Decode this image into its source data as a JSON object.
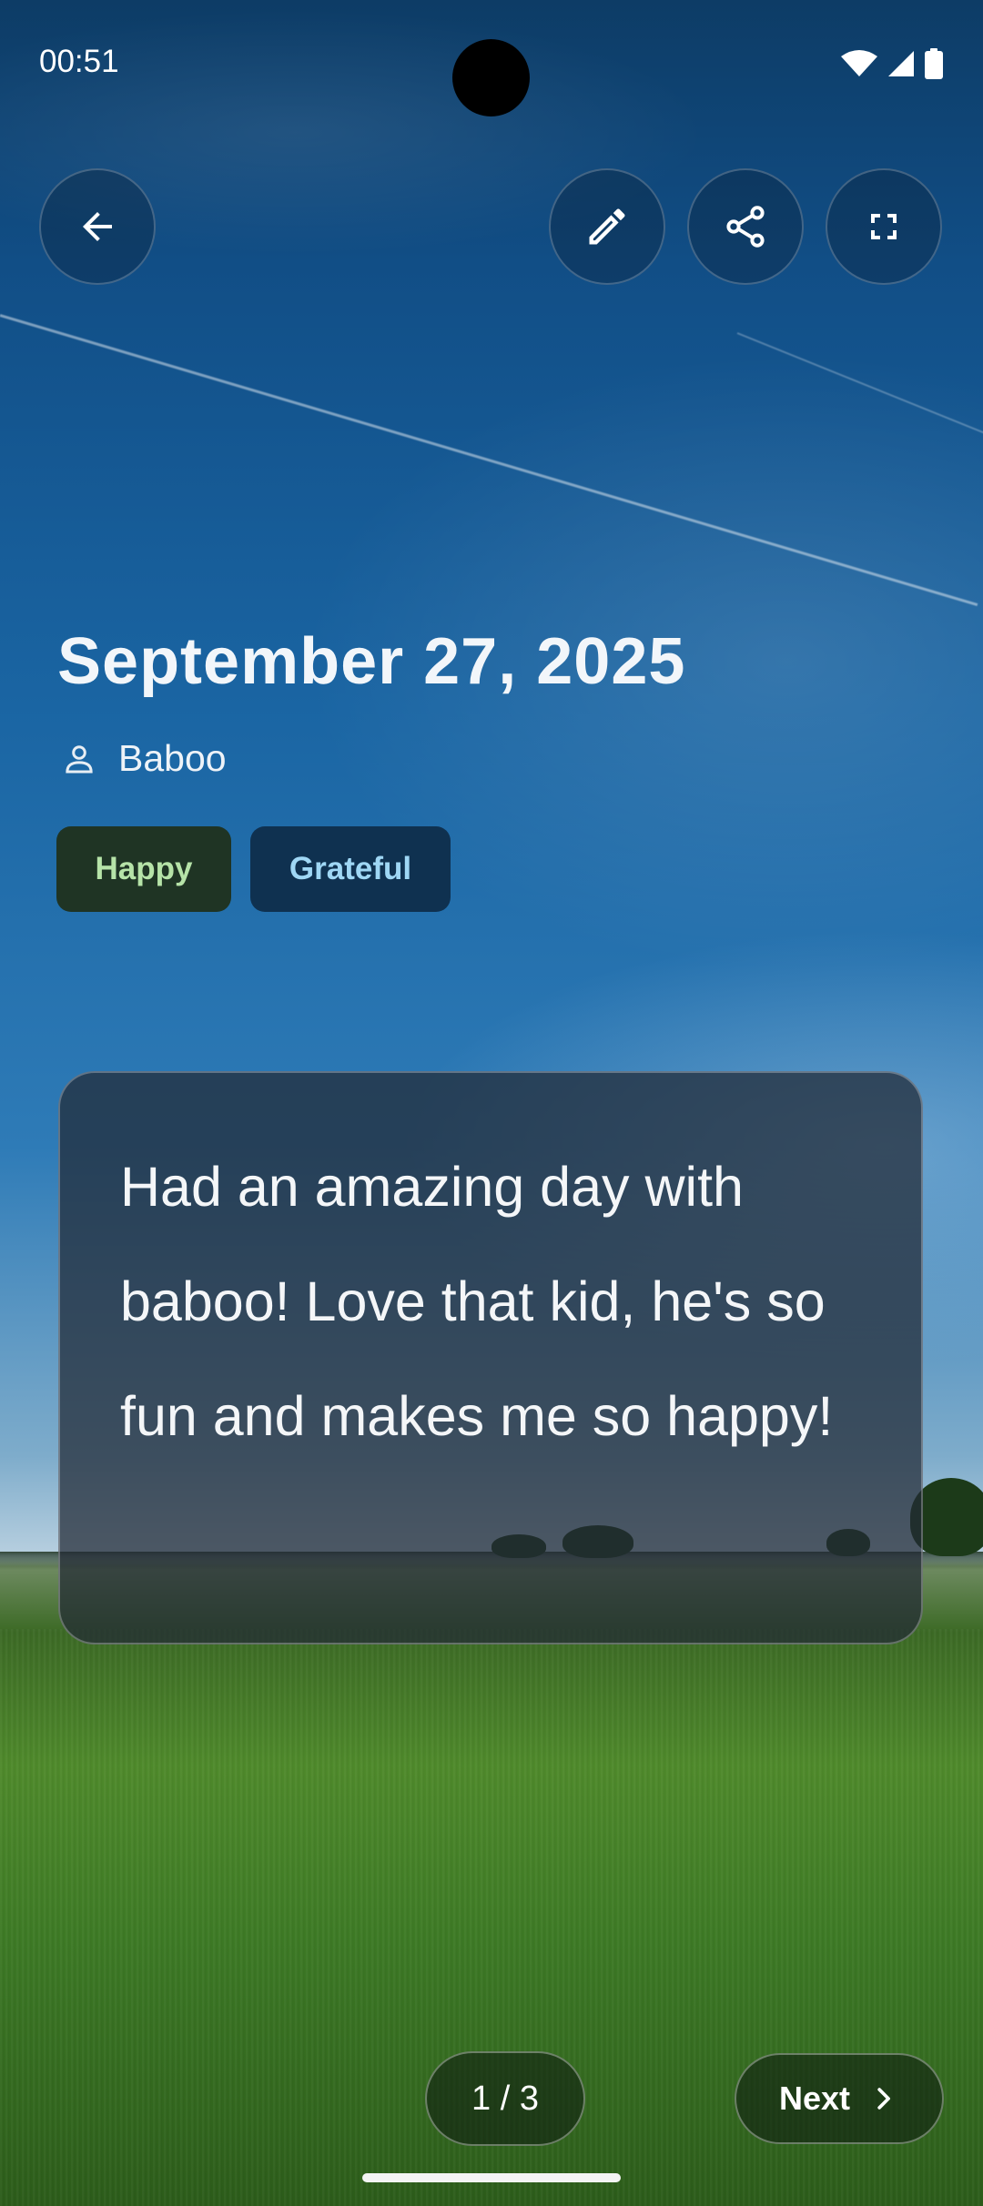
{
  "status_bar": {
    "time": "00:51",
    "icons": [
      "wifi-icon",
      "signal-icon",
      "battery-icon"
    ]
  },
  "toolbar": {
    "back": "arrow-back-icon",
    "edit": "pencil-icon",
    "share": "share-icon",
    "fullscreen": "fullscreen-icon"
  },
  "entry": {
    "date": "September 27, 2025",
    "author": "Baboo",
    "moods": [
      {
        "label": "Happy",
        "color": "#b6e3a8"
      },
      {
        "label": "Grateful",
        "color": "#9fd7f5"
      }
    ],
    "text": "Had an amazing day with baboo! Love that kid, he's so fun and makes me so happy!"
  },
  "pagination": {
    "label": "1 / 3",
    "next_label": "Next"
  }
}
